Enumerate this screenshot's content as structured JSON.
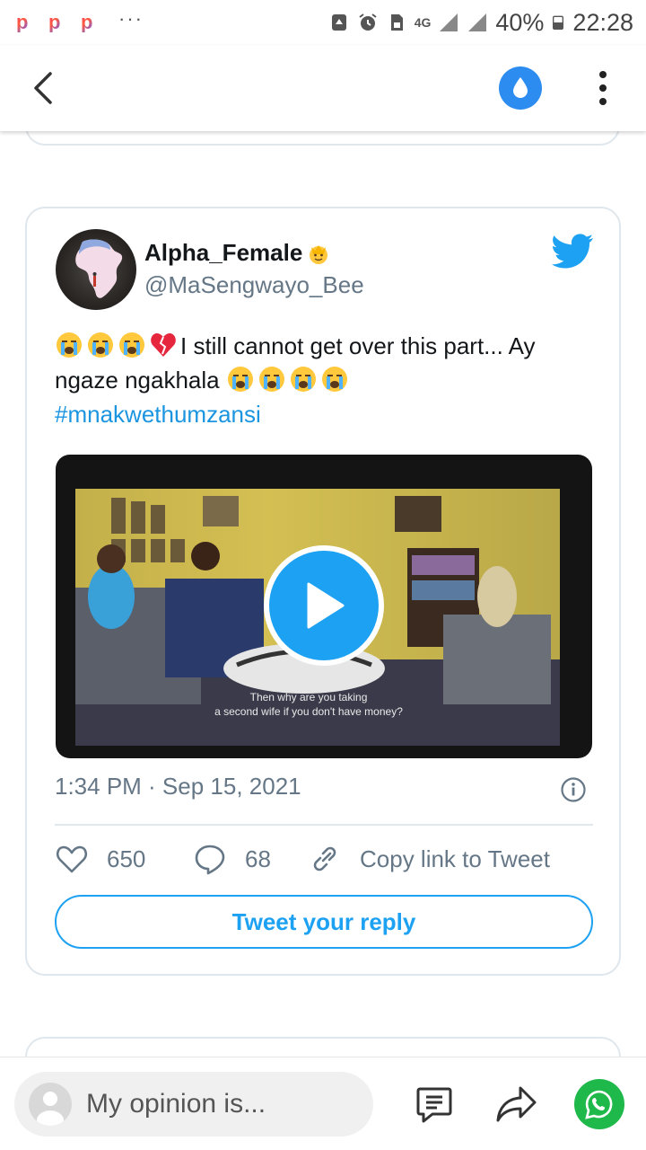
{
  "status_bar": {
    "app_icons": [
      "p-app-icon",
      "p-app-icon",
      "p-app-icon"
    ],
    "overflow_dots": "···",
    "network": "4G",
    "battery": "40%",
    "time": "22:28"
  },
  "app_bar": {
    "back_icon": "chevron-left-icon",
    "drop_icon": "water-drop-icon",
    "more_icon": "more-vertical-icon"
  },
  "tweet": {
    "display_name": "Alpha_Female",
    "handle": "@MaSengwayo_Bee",
    "text_line1": "I still cannot get over this part... Ay",
    "text_line2": "ngaze ngakhala",
    "hashtag": "#mnakwethumzansi",
    "video_caption_line1": "Then why are you taking",
    "video_caption_line2": "a second wife if you don't have money?",
    "timestamp": "1:34 PM · Sep 15, 2021",
    "likes": "650",
    "replies": "68",
    "copy_link": "Copy link to Tweet",
    "reply_button": "Tweet your reply"
  },
  "bottom_bar": {
    "placeholder": "My opinion is..."
  },
  "colors": {
    "twitter_blue": "#1da1f2",
    "hashtag_blue": "#1b95e0",
    "muted_gray": "#657786",
    "whatsapp_green": "#1fb84b",
    "drop_button_blue": "#2d8cf0"
  }
}
